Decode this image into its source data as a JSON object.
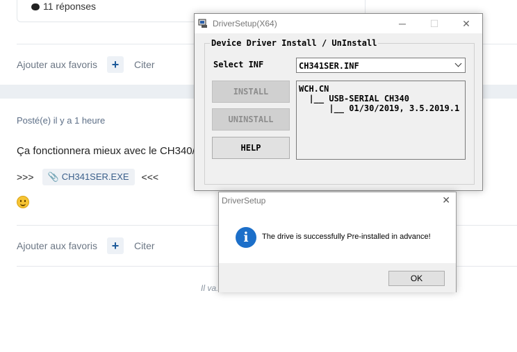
{
  "forum": {
    "reply_count": "11 réponses",
    "favorites_label": "Ajouter aux favoris",
    "plus_symbol": "+",
    "quote_label": "Citer",
    "posted": "Posté(e) il y a 1 heure",
    "body": "Ça fonctionnera mieux avec le CH340/",
    "attach_prefix": ">>>",
    "attach_name": "CH341SER.EXE",
    "attach_suffix": "<<<",
    "footer_quote": "Il va... er la médiocrité"
  },
  "driver_setup": {
    "title": "DriverSetup(X64)",
    "group_title": "Device Driver Install / UnInstall",
    "select_label": "Select INF",
    "selected_inf": "CH341SER.INF",
    "buttons": {
      "install": "INSTALL",
      "uninstall": "UNINSTALL",
      "help": "HELP"
    },
    "info_lines": [
      "WCH.CN",
      "  |__ USB-SERIAL CH340",
      "      |__ 01/30/2019, 3.5.2019.1"
    ]
  },
  "message_box": {
    "title": "DriverSetup",
    "text": "The drive is successfully Pre-installed in advance!",
    "ok_label": "OK",
    "icon_glyph": "i"
  },
  "colors": {
    "info_blue": "#1c6fc9",
    "link_blue": "#1d5a9a",
    "band": "#ebeff3"
  }
}
